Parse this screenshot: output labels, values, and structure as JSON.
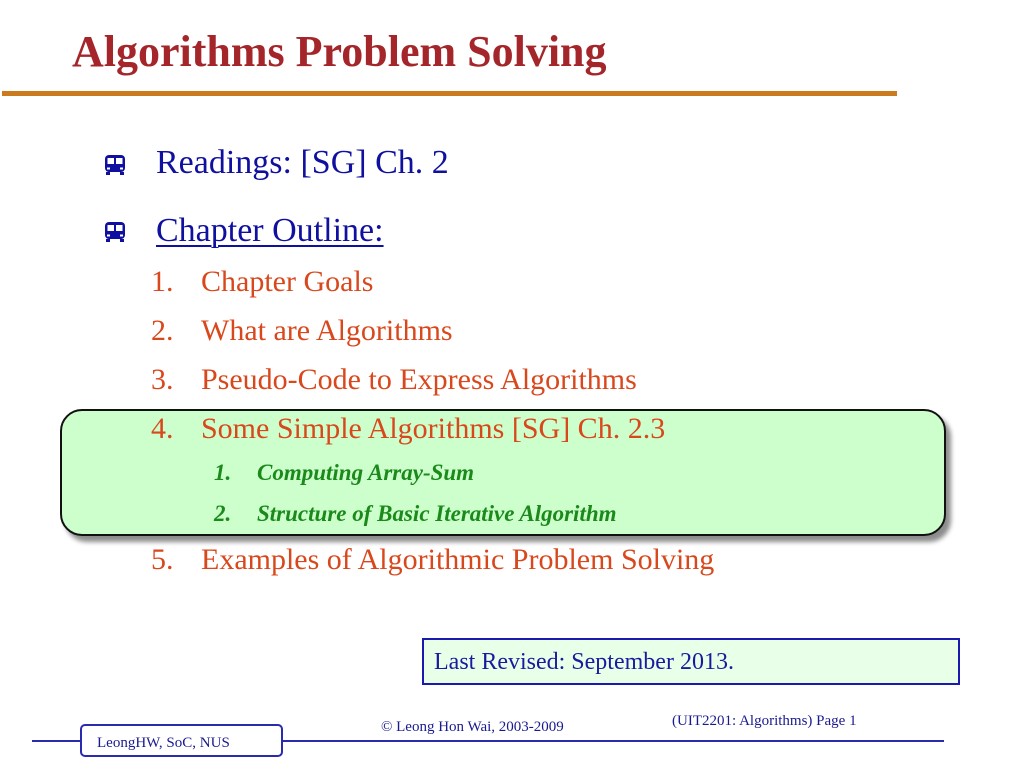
{
  "slide": {
    "title": "Algorithms Problem Solving",
    "colors": {
      "title": "#a5262a",
      "title_rule": "#cc7a1e",
      "bullet_text": "#1010a0",
      "outline_items": "#d9481c",
      "sub_items": "#1b8a1b",
      "highlight_fill": "#ccffcc",
      "footer": "#2a2ab0"
    },
    "bullets": [
      {
        "icon": "bus-icon",
        "text": "Readings:  [SG] Ch. 2",
        "underlined": false
      },
      {
        "icon": "bus-icon",
        "text": "Chapter Outline:",
        "underlined": true
      }
    ],
    "outline": [
      {
        "num": "1.",
        "text": "Chapter Goals"
      },
      {
        "num": "2.",
        "text": "What are Algorithms"
      },
      {
        "num": "3.",
        "text": "Pseudo-Code to Express Algorithms"
      },
      {
        "num": "4.",
        "text": "Some Simple Algorithms [SG] Ch. 2.3",
        "highlighted": true,
        "subitems": [
          {
            "num": "1.",
            "text": "Computing Array-Sum"
          },
          {
            "num": "2.",
            "text": "Structure of Basic Iterative Algorithm"
          }
        ]
      },
      {
        "num": "5.",
        "text": "Examples of Algorithmic Problem Solving"
      }
    ],
    "revised_note": "Last Revised: September 2013."
  },
  "footer": {
    "author_tag": "LeongHW, SoC, NUS",
    "copyright": "© Leong Hon Wai, 2003-2009",
    "course_page": "(UIT2201: Algorithms) Page 1"
  }
}
